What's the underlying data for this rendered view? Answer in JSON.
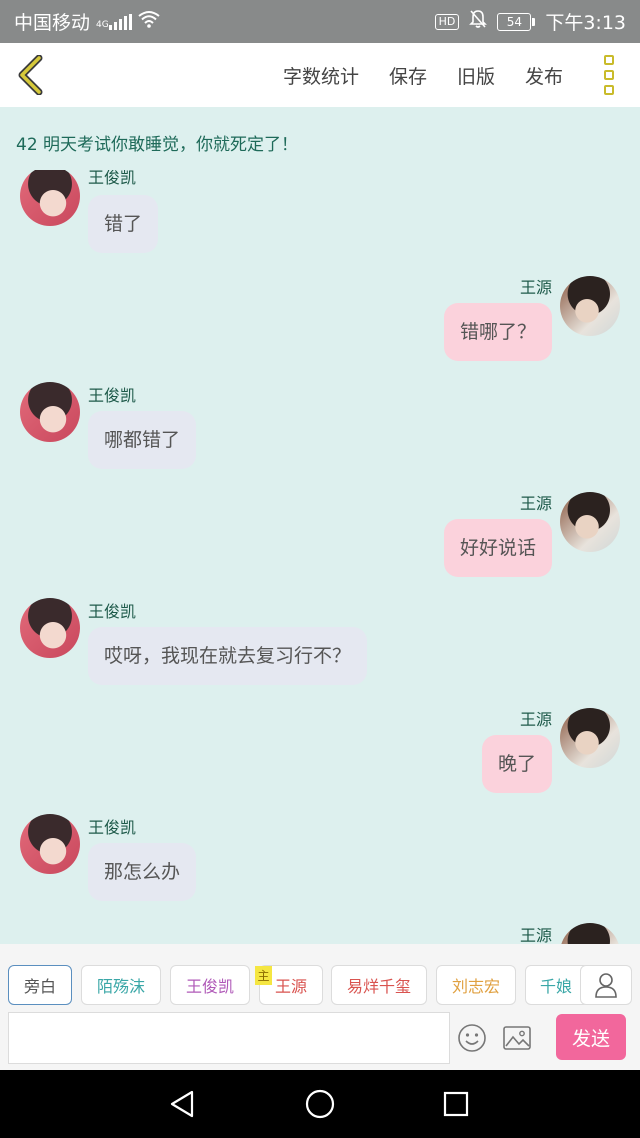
{
  "status_bar": {
    "carrier": "中国移动",
    "network": "4G",
    "hd": "HD",
    "battery": "54",
    "time": "下午3:13"
  },
  "header": {
    "actions": [
      "字数统计",
      "保存",
      "旧版",
      "发布"
    ],
    "accent_color": "#c9bb2a"
  },
  "chapter_title": "42 明天考试你敢睡觉，你就死定了！",
  "messages": [
    {
      "side": "left",
      "name": "王俊凯",
      "text": "错了"
    },
    {
      "side": "right",
      "name": "王源",
      "text": "错哪了？"
    },
    {
      "side": "left",
      "name": "王俊凯",
      "text": "哪都错了"
    },
    {
      "side": "right",
      "name": "王源",
      "text": "好好说话"
    },
    {
      "side": "left",
      "name": "王俊凯",
      "text": "哎呀，我现在就去复习行不？"
    },
    {
      "side": "right",
      "name": "王源",
      "text": "晚了"
    },
    {
      "side": "left",
      "name": "王俊凯",
      "text": "那怎么办"
    },
    {
      "side": "right",
      "name": "王源",
      "text": ""
    }
  ],
  "characters": [
    {
      "label": "旁白",
      "color": "#555555",
      "selected": true
    },
    {
      "label": "陌殇沫",
      "color": "#3aa7a7"
    },
    {
      "label": "王俊凯",
      "color": "#b05ab8"
    },
    {
      "label": "王源",
      "color": "#d9534f"
    },
    {
      "label": "易烊千玺",
      "color": "#d9534f"
    },
    {
      "label": "刘志宏",
      "color": "#e0a040"
    },
    {
      "label": "千娘",
      "color": "#3aa7a7"
    }
  ],
  "main_badge": "主",
  "input": {
    "value": "",
    "placeholder": ""
  },
  "send_label": "发送",
  "icons": {
    "back": "back-chevron-icon",
    "more": "more-options-icon",
    "user": "user-icon",
    "emoji": "emoji-icon",
    "image": "image-icon"
  }
}
